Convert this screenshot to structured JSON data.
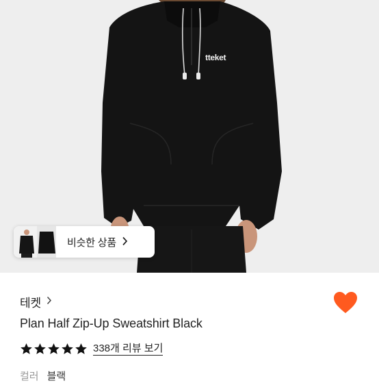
{
  "similar": {
    "label": "비슷한 상품"
  },
  "brand": {
    "name": "테켓"
  },
  "product": {
    "logo_text": "tteket",
    "title": "Plan Half Zip-Up Sweatshirt Black",
    "rating": 5,
    "review_link": "338개 리뷰 보기",
    "option_label": "컬러",
    "option_value": "블랙"
  },
  "colors": {
    "wishlist_heart": "#FF5A1F",
    "star": "#111111",
    "garment": "#141414"
  },
  "icons": [
    "chevron-right-icon",
    "heart-icon",
    "star-icon"
  ]
}
